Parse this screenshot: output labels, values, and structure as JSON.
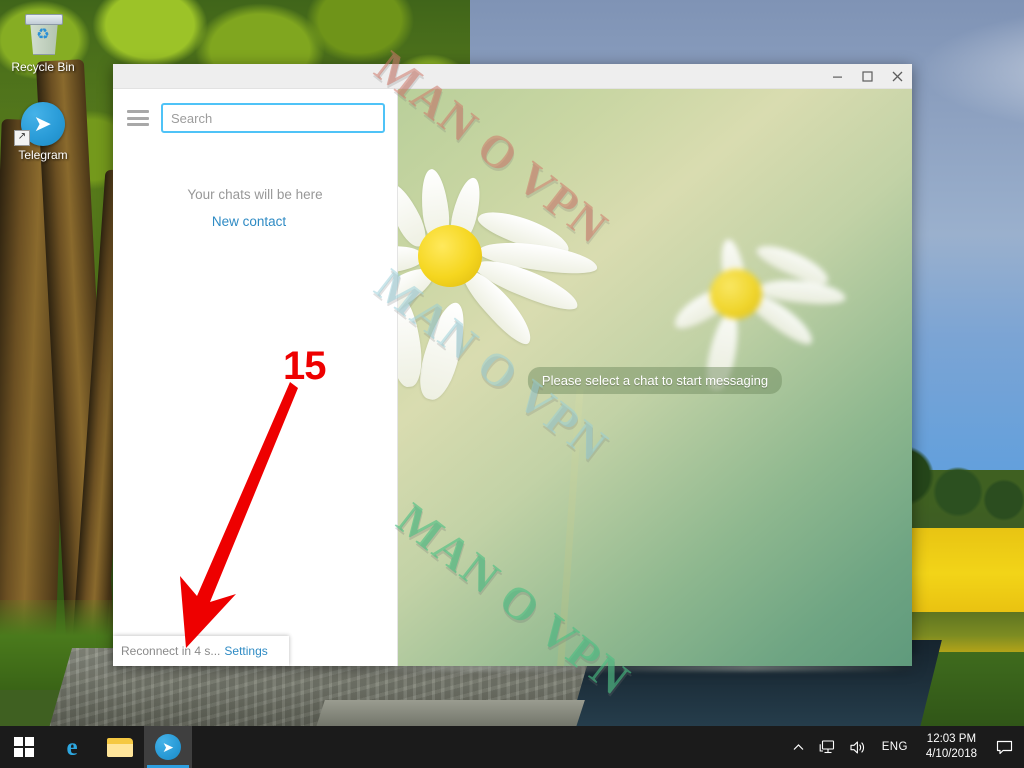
{
  "desktop": {
    "icons": [
      {
        "label": "Recycle Bin",
        "icon": "recycle-bin-icon"
      },
      {
        "label": "Telegram",
        "icon": "telegram-icon"
      }
    ]
  },
  "window": {
    "app": "Telegram Desktop",
    "controls": {
      "minimize": "–",
      "maximize": "❐",
      "close": "✕"
    }
  },
  "sidebar": {
    "menu_icon": "hamburger-menu-icon",
    "search": {
      "placeholder": "Search",
      "value": ""
    },
    "empty_state": {
      "title": "Your chats will be here",
      "action": "New contact"
    },
    "connection": {
      "status": "Reconnect in 4 s...",
      "settings_link": "Settings"
    }
  },
  "chat": {
    "placeholder": "Please select a chat to start messaging"
  },
  "watermarks": [
    {
      "text": "MAN O VPN",
      "color": "#cd7869"
    },
    {
      "text": "MAN O VPN",
      "color": "#96cdd7"
    },
    {
      "text": "MAN O VPN",
      "color": "#4bbe82"
    }
  ],
  "annotation": {
    "number": "15",
    "color": "#ee0000",
    "arrow": "down-left-arrow-icon"
  },
  "taskbar": {
    "start": "start-button",
    "items": [
      {
        "name": "edge",
        "icon": "edge-icon",
        "label": "e",
        "active": false
      },
      {
        "name": "file-explorer",
        "icon": "folder-icon",
        "label": "",
        "active": false
      },
      {
        "name": "telegram",
        "icon": "telegram-icon",
        "label": "",
        "active": true
      }
    ],
    "tray": {
      "show_hidden": "chevron-up-icon",
      "network": "network-icon",
      "volume": "volume-icon",
      "language": "ENG",
      "time": "12:03 PM",
      "date": "4/10/2018",
      "action_center": "notification-icon"
    }
  }
}
